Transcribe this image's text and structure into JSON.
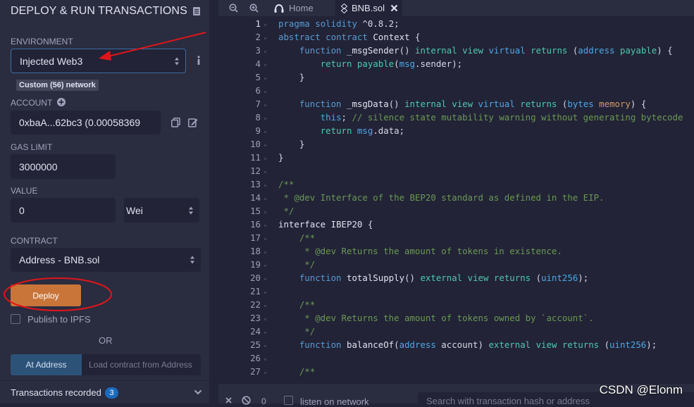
{
  "panel": {
    "title": "DEPLOY & RUN TRANSACTIONS",
    "environment_label": "ENVIRONMENT",
    "environment_value": "Injected Web3",
    "network_badge": "Custom (56) network",
    "account_label": "ACCOUNT",
    "account_value": "0xbaA...62bc3 (0.00058369",
    "gas_limit_label": "GAS LIMIT",
    "gas_limit_value": "3000000",
    "value_label": "VALUE",
    "value_amount": "0",
    "value_unit": "Wei",
    "contract_label": "CONTRACT",
    "contract_value": "Address - BNB.sol",
    "deploy_label": "Deploy",
    "publish_label": "Publish to IPFS",
    "or_label": "OR",
    "at_address_label": "At Address",
    "at_address_placeholder": "Load contract from Address",
    "transactions_label": "Transactions recorded",
    "transactions_count": "3"
  },
  "tabs": {
    "home_label": "Home",
    "file_label": "BNB.sol"
  },
  "editor": {
    "current_line": 1,
    "lines": [
      {
        "n": "1",
        "html": "<span class=\"kw\">pragma</span> <span class=\"kw\">solidity</span> ^0.8.2;"
      },
      {
        "n": "2",
        "html": "<span class=\"kw\">abstract</span> <span class=\"kw\">contract</span> <span class=\"fn\">Context</span> {"
      },
      {
        "n": "3",
        "html": "    <span class=\"kw\">function</span> <span class=\"fn\">_msgSender</span>() <span class=\"mod\">internal</span> <span class=\"mod\">view</span> <span class=\"ty\">virtual</span> <span class=\"mod\">returns</span> (<span class=\"ty\">address</span> <span class=\"mod\">payable</span>) {"
      },
      {
        "n": "4",
        "html": "        <span class=\"mod\">return</span> <span class=\"mod\">payable</span>(<span class=\"ty\">msg</span>.sender);"
      },
      {
        "n": "5",
        "html": "    }"
      },
      {
        "n": "6",
        "html": ""
      },
      {
        "n": "7",
        "html": "    <span class=\"kw\">function</span> <span class=\"fn\">_msgData</span>() <span class=\"mod\">internal</span> <span class=\"mod\">view</span> <span class=\"ty\">virtual</span> <span class=\"mod\">returns</span> (<span class=\"ty\">bytes</span> <span class=\"ptr\">memory</span>) {"
      },
      {
        "n": "8",
        "html": "        <span class=\"ty\">this</span>; <span class=\"cm\">// silence state mutability warning without generating bytecode</span>"
      },
      {
        "n": "9",
        "html": "        <span class=\"mod\">return</span> <span class=\"ty\">msg</span>.data;"
      },
      {
        "n": "10",
        "html": "    }"
      },
      {
        "n": "11",
        "html": "}"
      },
      {
        "n": "12",
        "html": ""
      },
      {
        "n": "13",
        "html": "<span class=\"cm\">/**</span>"
      },
      {
        "n": "14",
        "html": "<span class=\"cm\"> * @dev Interface of the BEP20 standard as defined in the EIP.</span>"
      },
      {
        "n": "15",
        "html": "<span class=\"cm\"> */</span>"
      },
      {
        "n": "16",
        "html": "<span class=\"fn\">interface</span> <span class=\"fn\">IBEP20</span> {"
      },
      {
        "n": "17",
        "html": "    <span class=\"cm\">/**</span>"
      },
      {
        "n": "18",
        "html": "<span class=\"cm\">     * @dev Returns the amount of tokens in existence.</span>"
      },
      {
        "n": "19",
        "html": "<span class=\"cm\">     */</span>"
      },
      {
        "n": "20",
        "html": "    <span class=\"kw\">function</span> <span class=\"fn\">totalSupply</span>() <span class=\"mod\">external</span> <span class=\"mod\">view</span> <span class=\"mod\">returns</span> (<span class=\"ty\">uint256</span>);"
      },
      {
        "n": "21",
        "html": ""
      },
      {
        "n": "22",
        "html": "    <span class=\"cm\">/**</span>"
      },
      {
        "n": "23",
        "html": "<span class=\"cm\">     * @dev Returns the amount of tokens owned by `account`.</span>"
      },
      {
        "n": "24",
        "html": "<span class=\"cm\">     */</span>"
      },
      {
        "n": "25",
        "html": "    <span class=\"kw\">function</span> <span class=\"fn\">balanceOf</span>(<span class=\"ty\">address</span> account) <span class=\"mod\">external</span> <span class=\"mod\">view</span> <span class=\"mod\">returns</span> (<span class=\"ty\">uint256</span>);"
      },
      {
        "n": "26",
        "html": ""
      },
      {
        "n": "27",
        "html": "    <span class=\"cm\">/**</span>"
      }
    ]
  },
  "bottom": {
    "pending_count": "0",
    "listen_label": "listen on network",
    "search_placeholder": "Search with transaction hash or address"
  },
  "watermark": "CSDN @Elonm"
}
